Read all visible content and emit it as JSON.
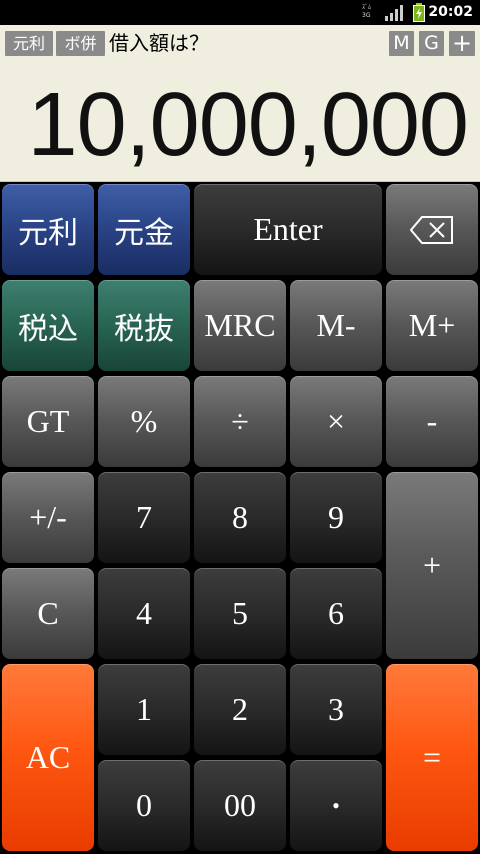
{
  "status_bar": {
    "time": "20:02",
    "sim_text": "ｽﾞﾑ 3G"
  },
  "display": {
    "tags_left": [
      "元利",
      "ボ併"
    ],
    "prompt": "借入額は？",
    "tags_right": [
      "M",
      "G",
      "+"
    ],
    "value": "10,000,000"
  },
  "keys": {
    "ganri": "元利",
    "gankin": "元金",
    "enter": "Enter",
    "zeikomi": "税込",
    "zeinuki": "税抜",
    "mrc": "MRC",
    "mminus": "M-",
    "mplus": "M+",
    "gt": "GT",
    "percent": "%",
    "divide": "÷",
    "multiply": "×",
    "minus": "-",
    "plusminus": "+/-",
    "seven": "7",
    "eight": "8",
    "nine": "9",
    "plus": "+",
    "clear": "C",
    "four": "4",
    "five": "5",
    "six": "6",
    "allclear": "AC",
    "one": "1",
    "two": "2",
    "three": "3",
    "equals": "=",
    "zero": "0",
    "doublezero": "00",
    "dot": "•"
  },
  "icons": {
    "backspace": "backspace-icon",
    "signal": "signal-icon",
    "battery": "battery-icon"
  }
}
